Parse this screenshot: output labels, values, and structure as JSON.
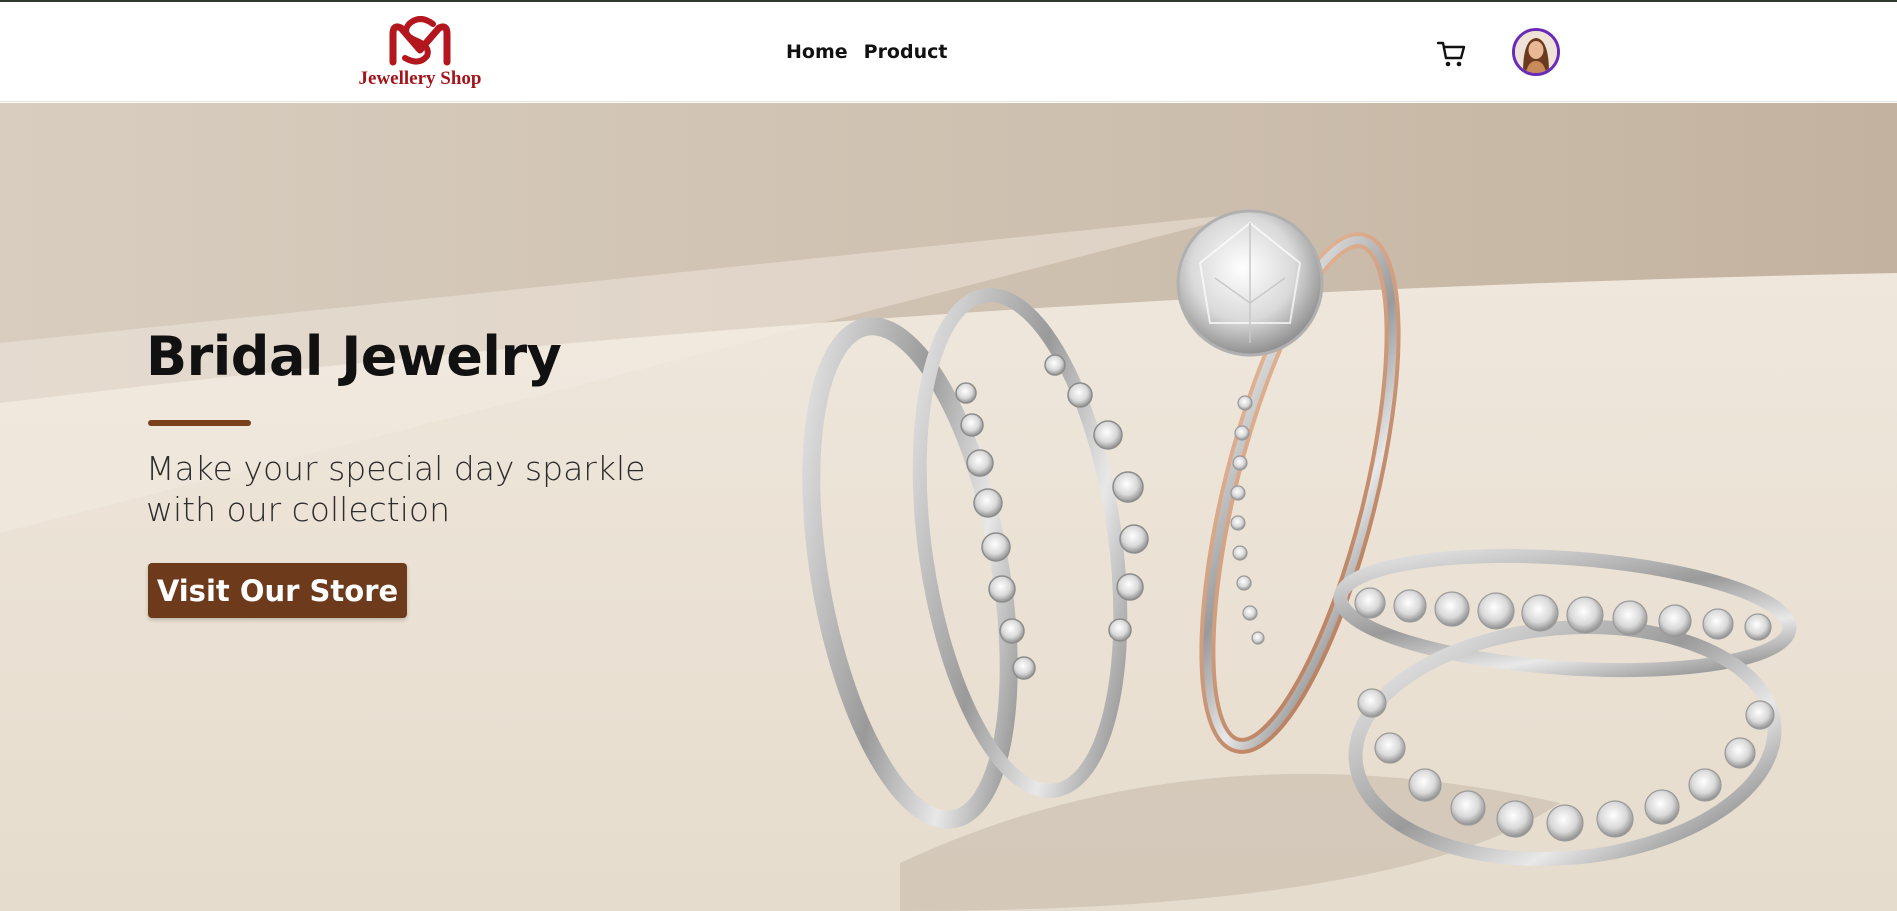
{
  "brand": {
    "name": "Jewellery Shop",
    "logo_color": "#a3141a"
  },
  "nav": {
    "links": [
      "Home",
      "Product"
    ]
  },
  "header_actions": {
    "cart_icon": "cart-icon",
    "avatar_border_color": "#6a2bb8"
  },
  "hero": {
    "title": "Bridal Jewelry",
    "subtitle": "Make your special day sparkle with our collection",
    "cta_label": "Visit Our Store",
    "accent_color": "#7a401c",
    "image_subject": "rings-image"
  }
}
